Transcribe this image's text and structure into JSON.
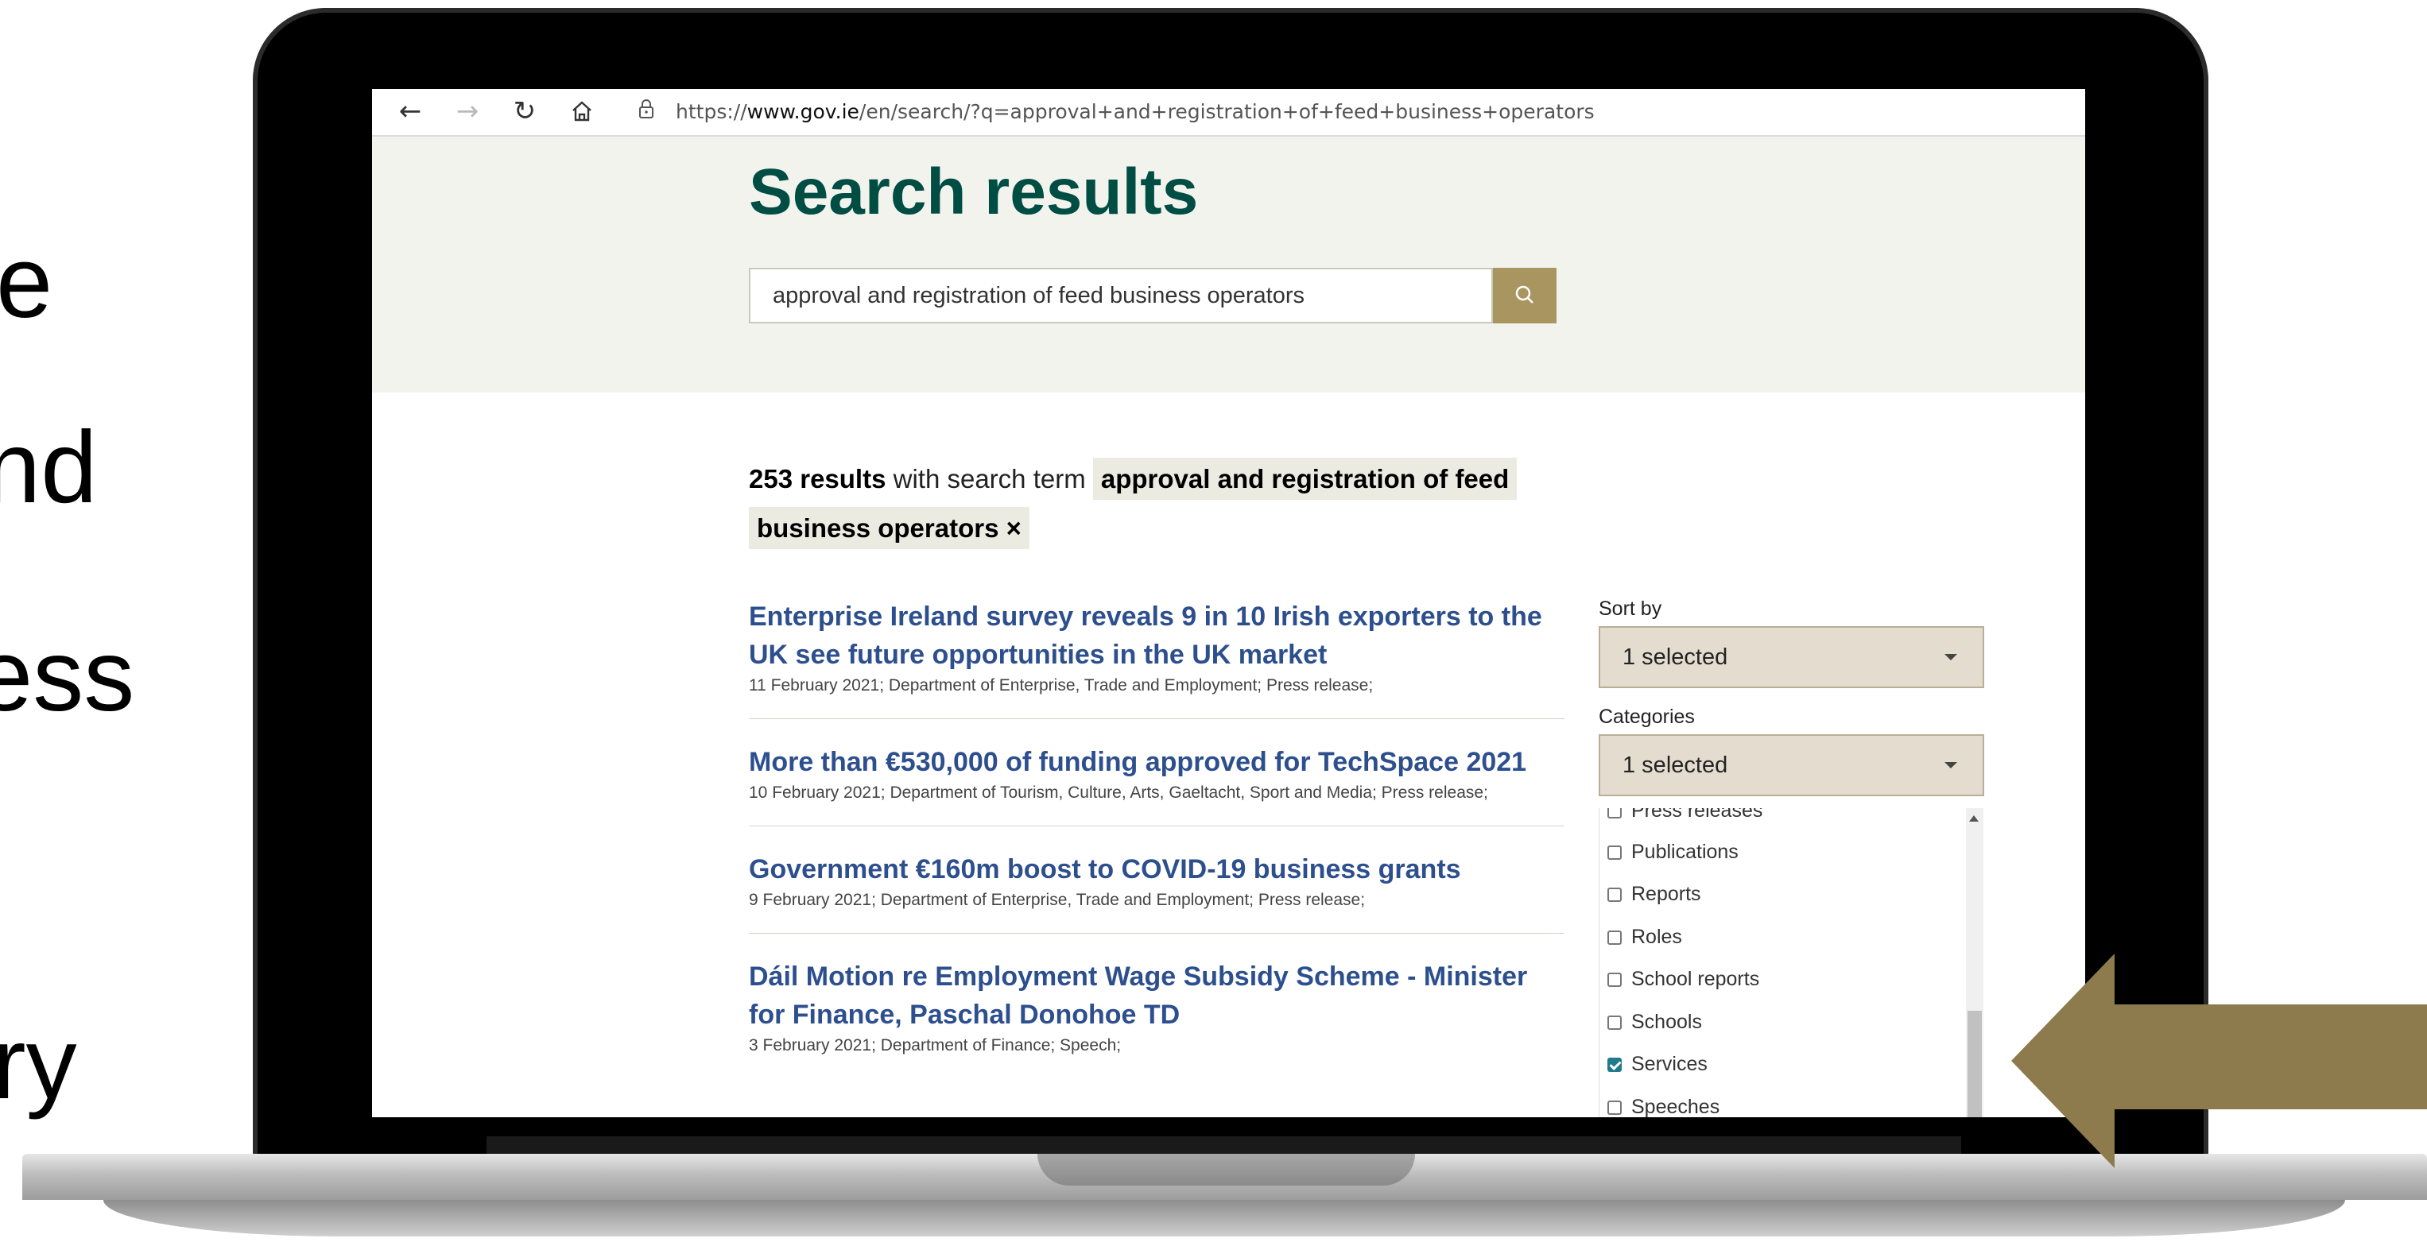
{
  "slide_fragments": [
    "e",
    "nd",
    "ess",
    "ry"
  ],
  "browser": {
    "url_prefix": "https://",
    "url_host": "www.gov.ie",
    "url_path": "/en/search/?q=approval+and+registration+of+feed+business+operators"
  },
  "page": {
    "title": "Search results",
    "search_value": "approval and registration of feed business operators",
    "summary_count": "253 results",
    "summary_text": " with search term ",
    "summary_term": "approval and registration of feed business operators ×"
  },
  "results": [
    {
      "title": "Enterprise Ireland survey reveals 9 in 10 Irish exporters to the UK see future opportunities in the UK market",
      "meta": "11 February 2021; Department of Enterprise, Trade and Employment; Press release;"
    },
    {
      "title": "More than €530,000 of funding approved for TechSpace 2021",
      "meta": "10 February 2021; Department of Tourism, Culture, Arts, Gaeltacht, Sport and Media; Press release;"
    },
    {
      "title": "Government €160m boost to COVID-19 business grants",
      "meta": "9 February 2021; Department of Enterprise, Trade and Employment; Press release;"
    },
    {
      "title": "Dáil Motion re Employment Wage Subsidy Scheme - Minister for Finance, Paschal Donohoe TD",
      "meta": "3 February 2021; Department of Finance; Speech;"
    }
  ],
  "sidebar": {
    "sort_label": "Sort by",
    "sort_value": "1 selected",
    "categories_label": "Categories",
    "categories_value": "1 selected",
    "category_options": [
      {
        "label": "Press releases",
        "checked": false
      },
      {
        "label": "Publications",
        "checked": false
      },
      {
        "label": "Reports",
        "checked": false
      },
      {
        "label": "Roles",
        "checked": false
      },
      {
        "label": "School reports",
        "checked": false
      },
      {
        "label": "Schools",
        "checked": false
      },
      {
        "label": "Services",
        "checked": true
      },
      {
        "label": "Speeches",
        "checked": false
      }
    ]
  },
  "colors": {
    "title_green": "#004d44",
    "link_blue": "#2d4f8e",
    "gold": "#a99560",
    "arrow_gold": "#8d7a4d"
  }
}
